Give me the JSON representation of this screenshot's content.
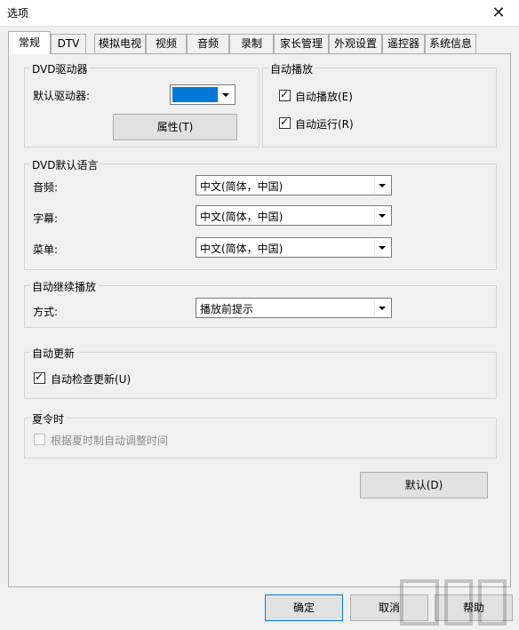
{
  "window": {
    "title": "选项"
  },
  "tabs": [
    "常规",
    "DTV",
    "模拟电视",
    "视频",
    "音频",
    "录制",
    "家长管理",
    "外观设置",
    "遥控器",
    "系统信息"
  ],
  "dvd_drive": {
    "legend": "DVD驱动器",
    "default_label": "默认驱动器:",
    "selected_color": "#0078d7",
    "properties_button": "属性(T)"
  },
  "autoplay": {
    "legend": "自动播放",
    "autoplay_label": "自动播放(E)",
    "autorun_label": "自动运行(R)",
    "autoplay_checked": "✓",
    "autorun_checked": "✓"
  },
  "dvd_language": {
    "legend": "DVD默认语言",
    "audio_label": "音频:",
    "subtitle_label": "字幕:",
    "menu_label": "菜单:",
    "audio_value": "中文(简体，中国)",
    "subtitle_value": "中文(简体，中国)",
    "menu_value": "中文(简体，中国)"
  },
  "resume": {
    "legend": "自动继续播放",
    "mode_label": "方式:",
    "mode_value": "播放前提示"
  },
  "update": {
    "legend": "自动更新",
    "check_label": "自动检查更新(U)",
    "check_checked": "✓"
  },
  "dst": {
    "legend": "夏令时",
    "adjust_label": "根据夏时制自动调整时间"
  },
  "buttons": {
    "default": "默认(D)",
    "ok": "确定",
    "cancel": "取消",
    "help": "帮助"
  }
}
